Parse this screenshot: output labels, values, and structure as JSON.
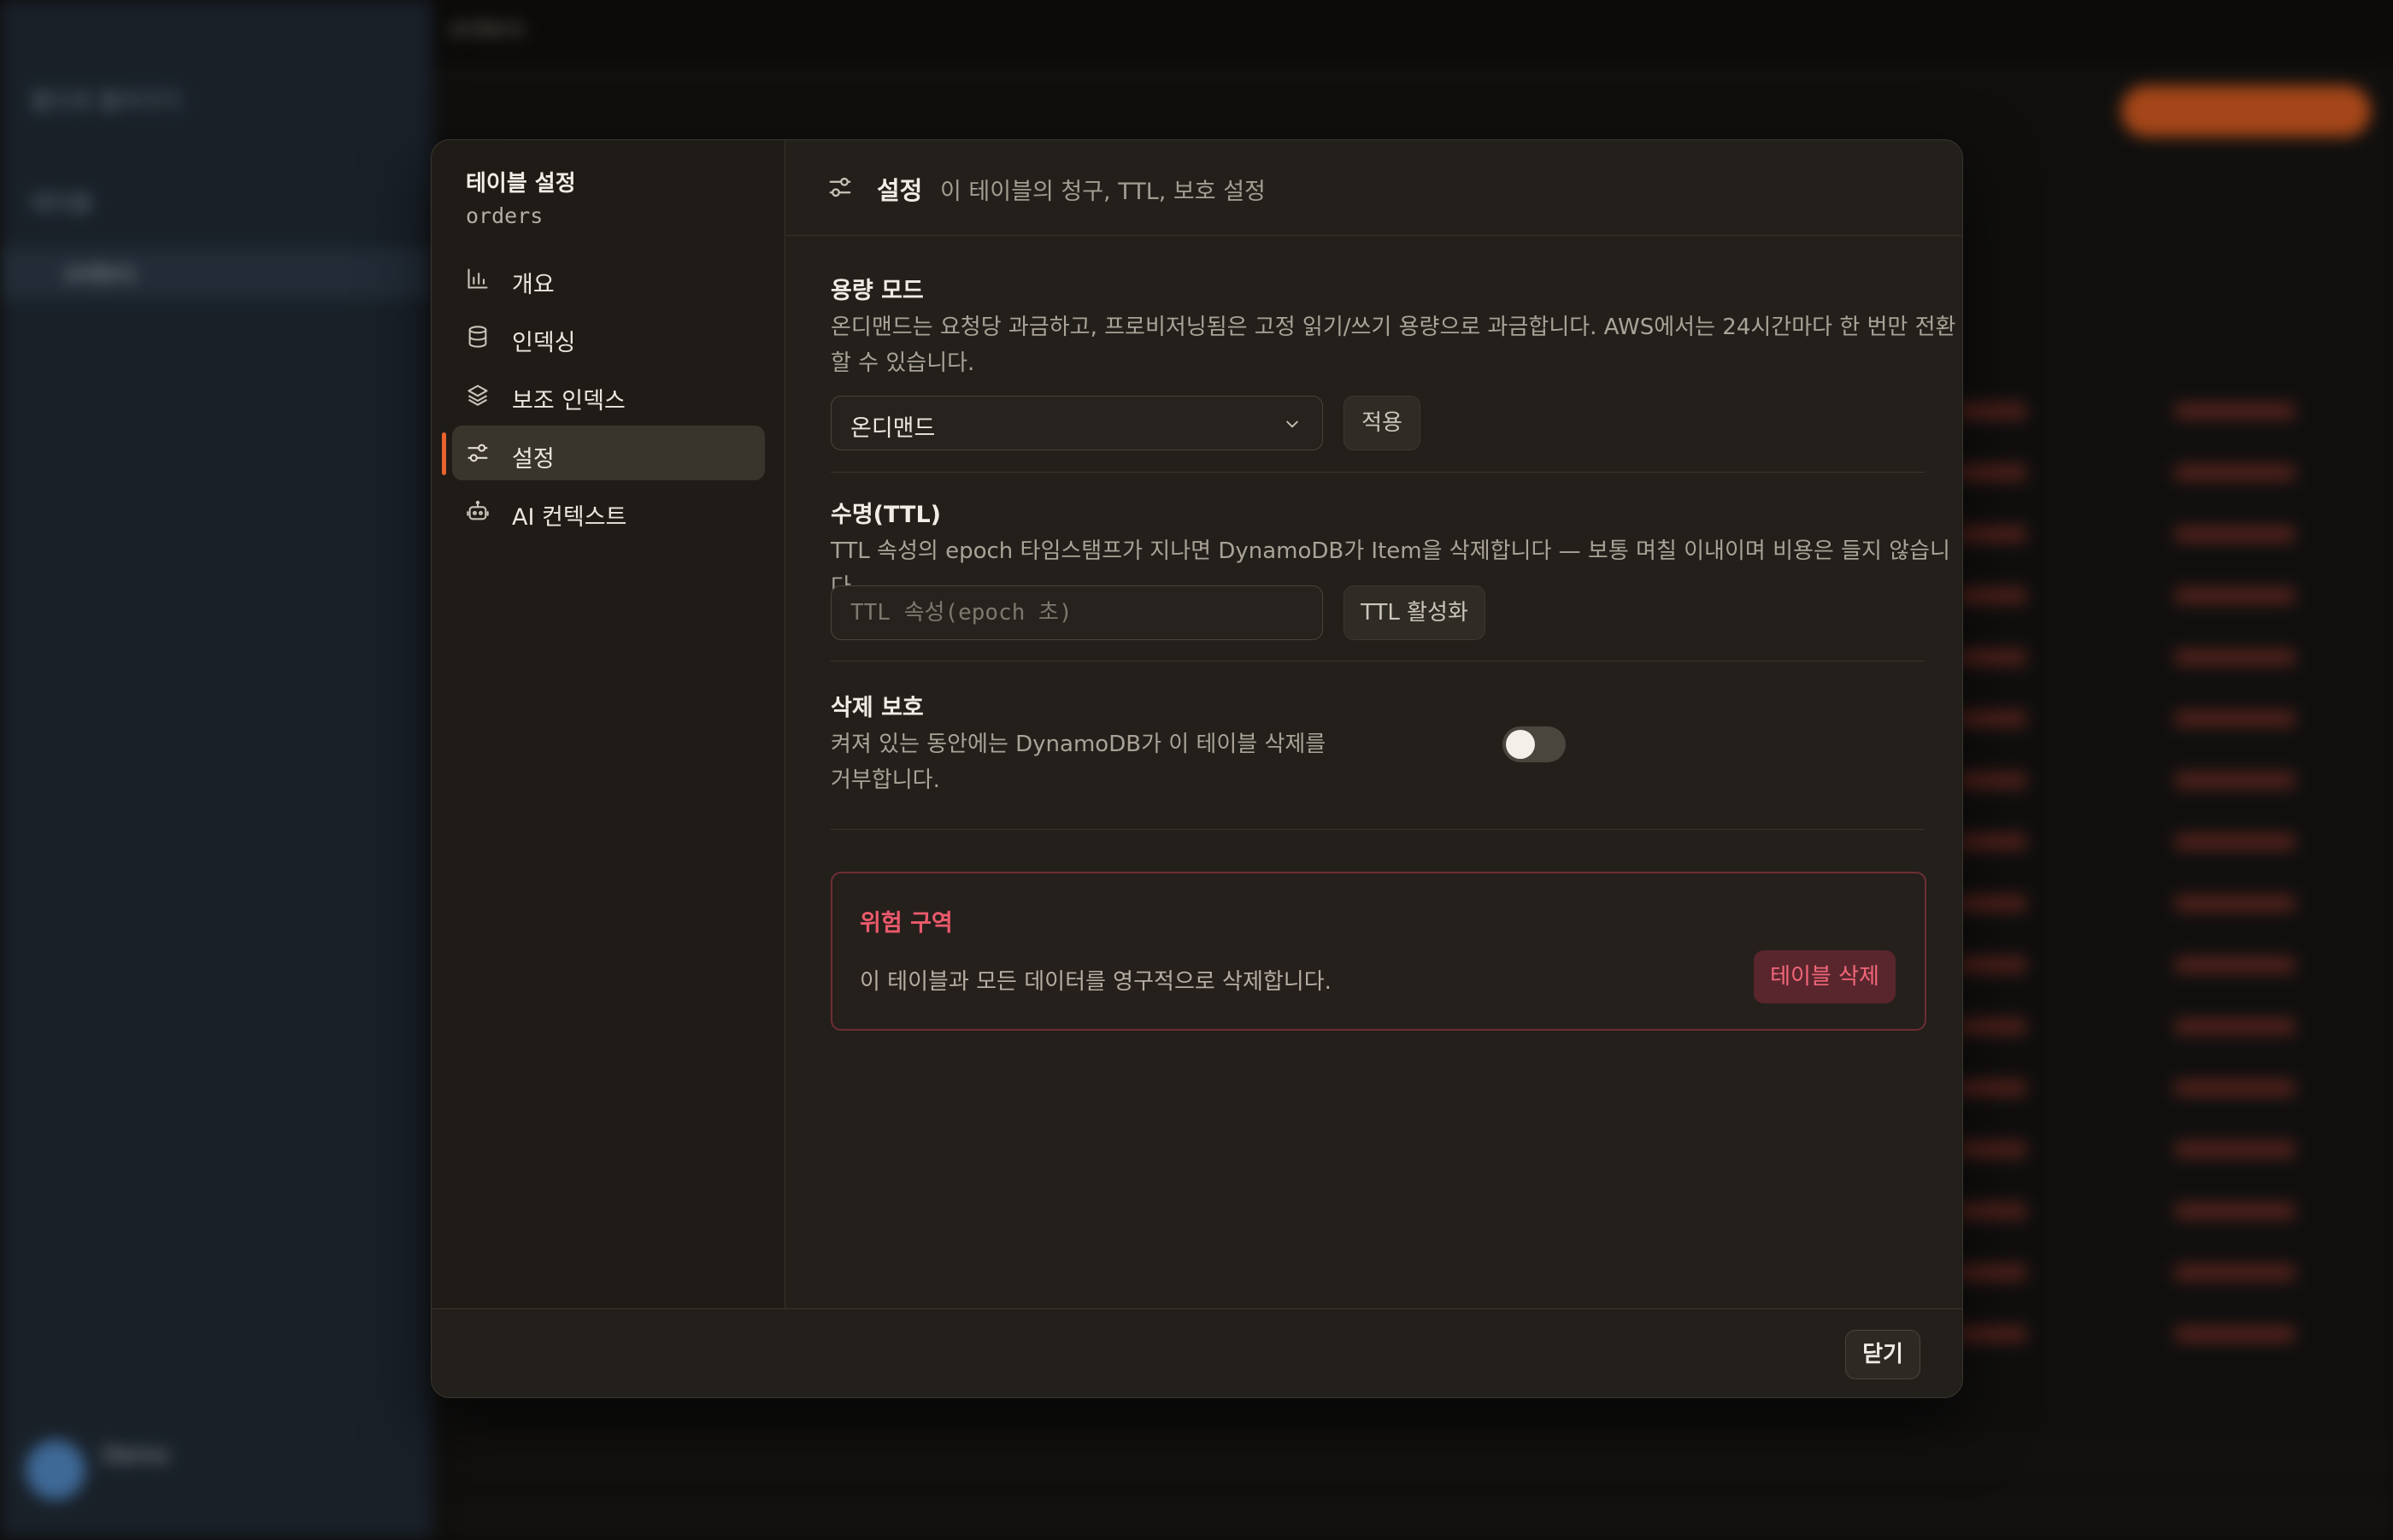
{
  "background": {
    "sidebar": {
      "back_label": "홈으로 돌아가기",
      "section_label": "테이블",
      "active_table": "orders"
    },
    "topbar": {
      "title": "orders"
    },
    "user": {
      "name": "Demo"
    }
  },
  "nav": {
    "title": "테이블 설정",
    "table_name": "orders",
    "items": [
      {
        "label": "개요",
        "icon": "bar-chart-icon"
      },
      {
        "label": "인덱싱",
        "icon": "database-icon"
      },
      {
        "label": "보조 인덱스",
        "icon": "layers-icon"
      },
      {
        "label": "설정",
        "icon": "sliders-icon"
      },
      {
        "label": "AI 컨텍스트",
        "icon": "robot-icon"
      }
    ],
    "active_index": 3
  },
  "header": {
    "title": "설정",
    "subtitle": "이 테이블의 청구, TTL, 보호 설정"
  },
  "capacity": {
    "title": "용량 모드",
    "desc_line1": "온디맨드는 요청당 과금하고, 프로비저닝됨은 고정 읽기/쓰기 용량으로 과금합니다. AWS에서는 24시간마다 한 번만 전환",
    "desc_line2": "할 수 있습니다.",
    "selected": "온디맨드",
    "apply_label": "적용"
  },
  "ttl": {
    "title": "수명(TTL)",
    "desc": "TTL 속성의 epoch 타임스탬프가 지나면 DynamoDB가 Item을 삭제합니다 — 보통 며칠 이내이며 비용은 들지 않습니다.",
    "placeholder": "TTL 속성(epoch 초)",
    "enable_label": "TTL 활성화"
  },
  "deletion_protection": {
    "title": "삭제 보호",
    "desc_line1": "켜져 있는 동안에는 DynamoDB가 이 테이블 삭제를",
    "desc_line2": "거부합니다.",
    "enabled": false
  },
  "danger": {
    "title": "위험 구역",
    "desc": "이 테이블과 모든 데이터를 영구적으로 삭제합니다.",
    "button_label": "테이블 삭제"
  },
  "footer": {
    "close_label": "닫기"
  },
  "colors": {
    "accent": "#e8622c",
    "danger": "#ec5a6c"
  }
}
